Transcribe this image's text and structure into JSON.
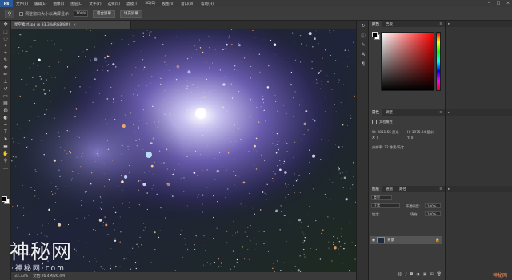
{
  "app": {
    "logo": "Ps",
    "menus": [
      "文件(F)",
      "编辑(E)",
      "图像(I)",
      "图层(L)",
      "文字(Y)",
      "选择(S)",
      "滤镜(T)",
      "3D(D)",
      "视图(V)",
      "窗口(W)",
      "帮助(H)"
    ]
  },
  "options": {
    "checkbox_label": "调整窗口大小以满屏显示",
    "zoom_value": "100%",
    "btn_fit": "适合屏幕",
    "btn_fill": "填充屏幕"
  },
  "document": {
    "tab_title": "星空素材.jpg @ 33.3%(RGB/8#)",
    "tab_close": "×"
  },
  "status": {
    "zoom": "33.33%",
    "doc_info": "文档:26.4M/26.4M"
  },
  "panels": {
    "color_tab": "颜色",
    "swatches_tab": "色板",
    "properties_tab": "属性",
    "adjust_tab": "调整",
    "props_title": "文档属性",
    "props_w": "W: 2851.55 厘米",
    "props_h": "H: 1975.24 厘米",
    "props_x": "X: 0",
    "props_y": "Y: 0",
    "props_res": "分辨率: 72 像素/英寸",
    "layers_tab": "图层",
    "channels_tab": "通道",
    "paths_tab": "路径",
    "kind_label": "类型",
    "blend_mode": "正常",
    "opacity_label": "不透明度:",
    "opacity_value": "100%",
    "lock_label": "锁定:",
    "fill_label": "填充:",
    "fill_value": "100%",
    "layer_name": "背景"
  },
  "watermark": {
    "main": "神秘网",
    "sub": "·神秘网·com",
    "corner": "神秘网"
  }
}
